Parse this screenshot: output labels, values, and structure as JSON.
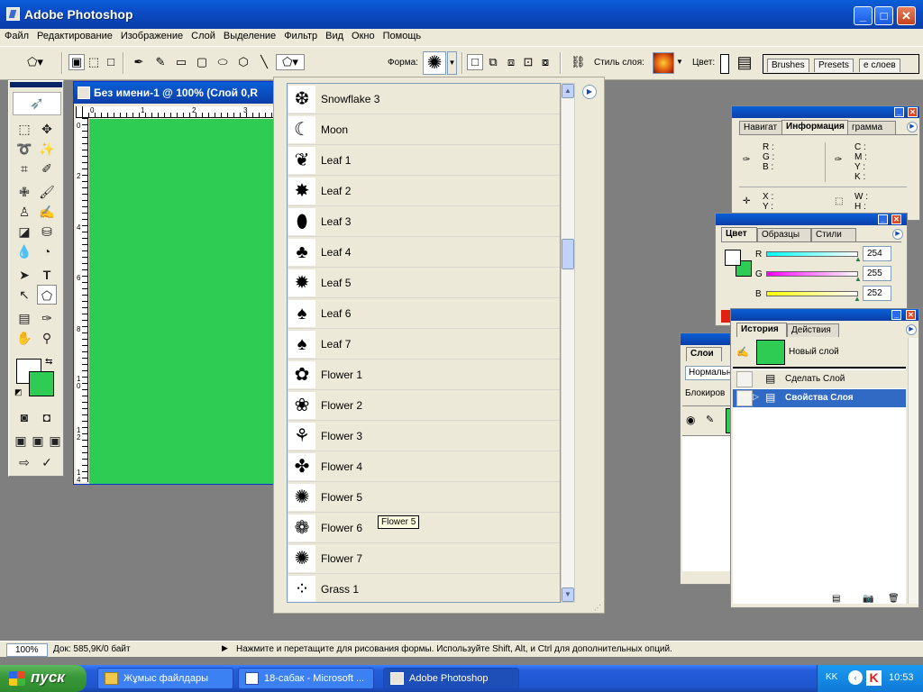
{
  "window": {
    "title": "Adobe Photoshop"
  },
  "menu": [
    "Файл",
    "Редактирование",
    "Изображение",
    "Слой",
    "Выделение",
    "Фильтр",
    "Вид",
    "Окно",
    "Помощь"
  ],
  "options": {
    "shape_label": "Форма:",
    "layer_style_label": "Стиль слоя:",
    "color_label": "Цвет:",
    "well_tabs": [
      "Brushes",
      "Presets",
      "е слоев"
    ]
  },
  "document": {
    "title": "Без имени-1 @ 100% (Слой 0,R",
    "ruler_h": [
      "0",
      "1",
      "2",
      "3"
    ],
    "ruler_v": [
      "0",
      "2",
      "4",
      "6",
      "8",
      "1\n0",
      "1\n2",
      "1\n4"
    ],
    "canvas_color": "#2ecc52"
  },
  "shapes": [
    {
      "name": "Snowflake 3",
      "icon": "❆"
    },
    {
      "name": "Moon",
      "icon": "☾"
    },
    {
      "name": "Leaf 1",
      "icon": "❦"
    },
    {
      "name": "Leaf 2",
      "icon": "✸"
    },
    {
      "name": "Leaf 3",
      "icon": "⬮"
    },
    {
      "name": "Leaf 4",
      "icon": "♣"
    },
    {
      "name": "Leaf 5",
      "icon": "✹"
    },
    {
      "name": "Leaf 6",
      "icon": "♠"
    },
    {
      "name": "Leaf 7",
      "icon": "♠"
    },
    {
      "name": "Flower 1",
      "icon": "✿"
    },
    {
      "name": "Flower 2",
      "icon": "❀"
    },
    {
      "name": "Flower 3",
      "icon": "⚘"
    },
    {
      "name": "Flower 4",
      "icon": "✤"
    },
    {
      "name": "Flower 5",
      "icon": "✺"
    },
    {
      "name": "Flower 6",
      "icon": "❁"
    },
    {
      "name": "Flower 7",
      "icon": "✺"
    },
    {
      "name": "Grass 1",
      "icon": "⁘"
    }
  ],
  "tooltip": "Flower 5",
  "info_panel": {
    "tabs": [
      "Навигат",
      "Информация",
      "грамма"
    ],
    "rgb": [
      "R :",
      "G :",
      "B :"
    ],
    "cmyk": [
      "C :",
      "M :",
      "Y :",
      "K :"
    ],
    "xy": [
      "X :",
      "Y :"
    ],
    "wh": [
      "W :",
      "H :"
    ]
  },
  "color_panel": {
    "tabs": [
      "Цвет",
      "Образцы",
      "Стили"
    ],
    "channels": [
      {
        "label": "R",
        "value": "254",
        "fraction": 0.996,
        "grad": "linear-gradient(90deg,#00ffff,#ffffff)"
      },
      {
        "label": "G",
        "value": "255",
        "fraction": 1.0,
        "grad": "linear-gradient(90deg,#fe00fc,#ffffff)"
      },
      {
        "label": "B",
        "value": "252",
        "fraction": 0.988,
        "grad": "linear-gradient(90deg,#feff00,#ffffff)"
      }
    ]
  },
  "layers_panel": {
    "tabs": [
      "Слои"
    ],
    "mode": "Нормальн",
    "lock_label": "Блокиров"
  },
  "history_panel": {
    "tabs": [
      "История",
      "Действия"
    ],
    "snapshot": "Новый слой",
    "items": [
      "Сделать Слой",
      "Свойства Слоя"
    ]
  },
  "status": {
    "zoom": "100%",
    "doc_info": "Док: 585,9К/0 байт",
    "hint": "Нажмите и перетащите для рисования формы. Используйте Shift, Alt, и Ctrl для дополнительных опций."
  },
  "taskbar": {
    "start": "пуск",
    "items": [
      "Жұмыс файлдары",
      "18-сабак - Microsoft ...",
      "Adobe Photoshop"
    ],
    "lang": "KK",
    "clock": "10:53"
  }
}
